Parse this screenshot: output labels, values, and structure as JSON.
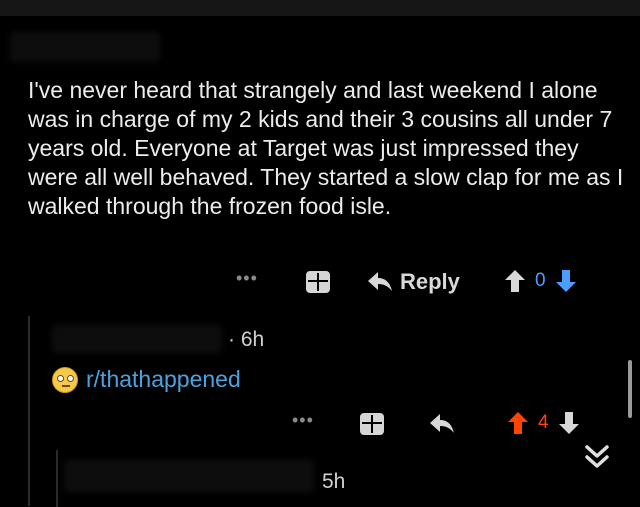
{
  "comment": {
    "body": "I've never heard that strangely and last weekend I alone was in charge of my 2 kids and their 3 cousins all under 7 years old. Everyone at Target was just impressed they were all well behaved. They started a slow clap for me as I walked through the frozen food isle.",
    "actions": {
      "more": "•••",
      "reply_label": "Reply",
      "score": "0"
    }
  },
  "reply_comment": {
    "time": "· 6h",
    "flair": "r/thathappened",
    "actions": {
      "more": "•••",
      "score": "4"
    }
  },
  "next_comment": {
    "time": "5h"
  },
  "colors": {
    "upvote_active": "#ff4500",
    "link": "#4aa3e0",
    "downvote": "#4a9eff"
  },
  "icons": [
    "gift-icon",
    "reply-arrow-icon",
    "upvote-icon",
    "downvote-icon",
    "eye-roll-emoji-icon",
    "collapse-chevrons-icon"
  ]
}
